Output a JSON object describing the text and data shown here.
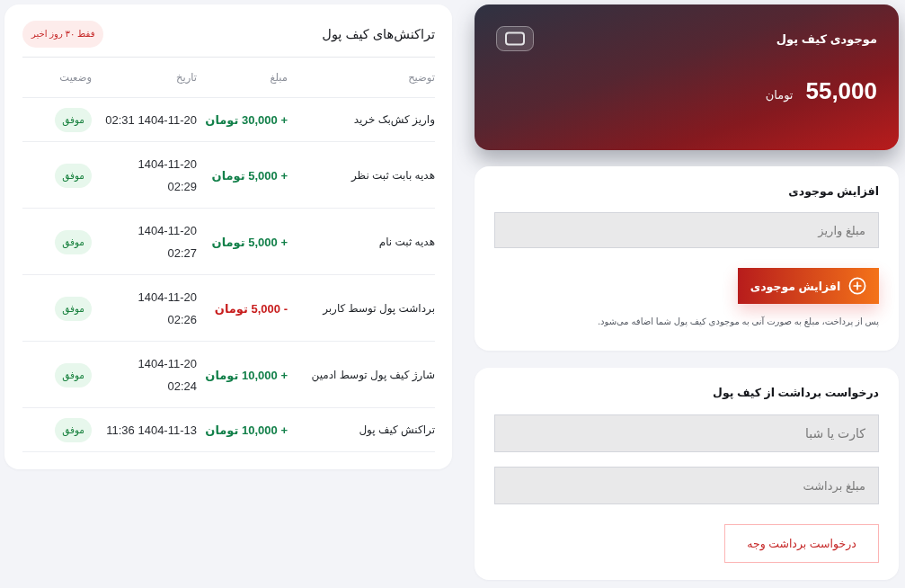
{
  "wallet_card": {
    "title": "موجودی کیف پول",
    "balance": "55,000",
    "currency": "تومان"
  },
  "deposit": {
    "title": "افزایش موجودی",
    "amount_field": {
      "placeholder": "مبلغ واریز"
    },
    "button": "افزایش موجودی",
    "note": "پس از پرداخت، مبلغ به صورت آنی به موجودی کیف پول شما اضافه می‌شود."
  },
  "withdrawal": {
    "title": "درخواست برداشت از کیف پول",
    "fields": [
      {
        "placeholder": "کارت یا شبا"
      },
      {
        "placeholder": "مبلغ برداشت"
      }
    ],
    "button": "درخواست برداشت وجه"
  },
  "transactions": {
    "title": "تراکنش‌های کیف پول",
    "badge": "فقط ۳۰ روز اخیر",
    "table": {
      "columns": [
        "توضیح",
        "مبلغ",
        "تاریخ",
        "وضعیت"
      ],
      "rows": [
        {
          "description": "واریز کش‌بک خرید",
          "amount": "+ 30,000 تومان",
          "kind": "credit",
          "date": "1404-11-20 02:31",
          "status": "موفق"
        },
        {
          "description": "هدیه بابت ثبت نظر",
          "amount": "+ 5,000 تومان",
          "kind": "credit",
          "date": "1404-11-20\n02:29",
          "status": "موفق"
        },
        {
          "description": "هدیه ثبت نام",
          "amount": "+ 5,000 تومان",
          "kind": "credit",
          "date": "1404-11-20\n02:27",
          "status": "موفق"
        },
        {
          "description": "برداشت پول توسط کاربر",
          "amount": "- 5,000 تومان",
          "kind": "debit",
          "date": "1404-11-20\n02:26",
          "status": "موفق"
        },
        {
          "description": "شارژ کیف پول توسط ادمین",
          "amount": "+ 10,000 تومان",
          "kind": "credit",
          "date": "1404-11-20\n02:24",
          "status": "موفق"
        },
        {
          "description": "تراکنش کیف پول",
          "amount": "+ 10,000 تومان",
          "kind": "credit",
          "date": "1404-11-13 11:36",
          "status": "موفق"
        }
      ]
    }
  }
}
